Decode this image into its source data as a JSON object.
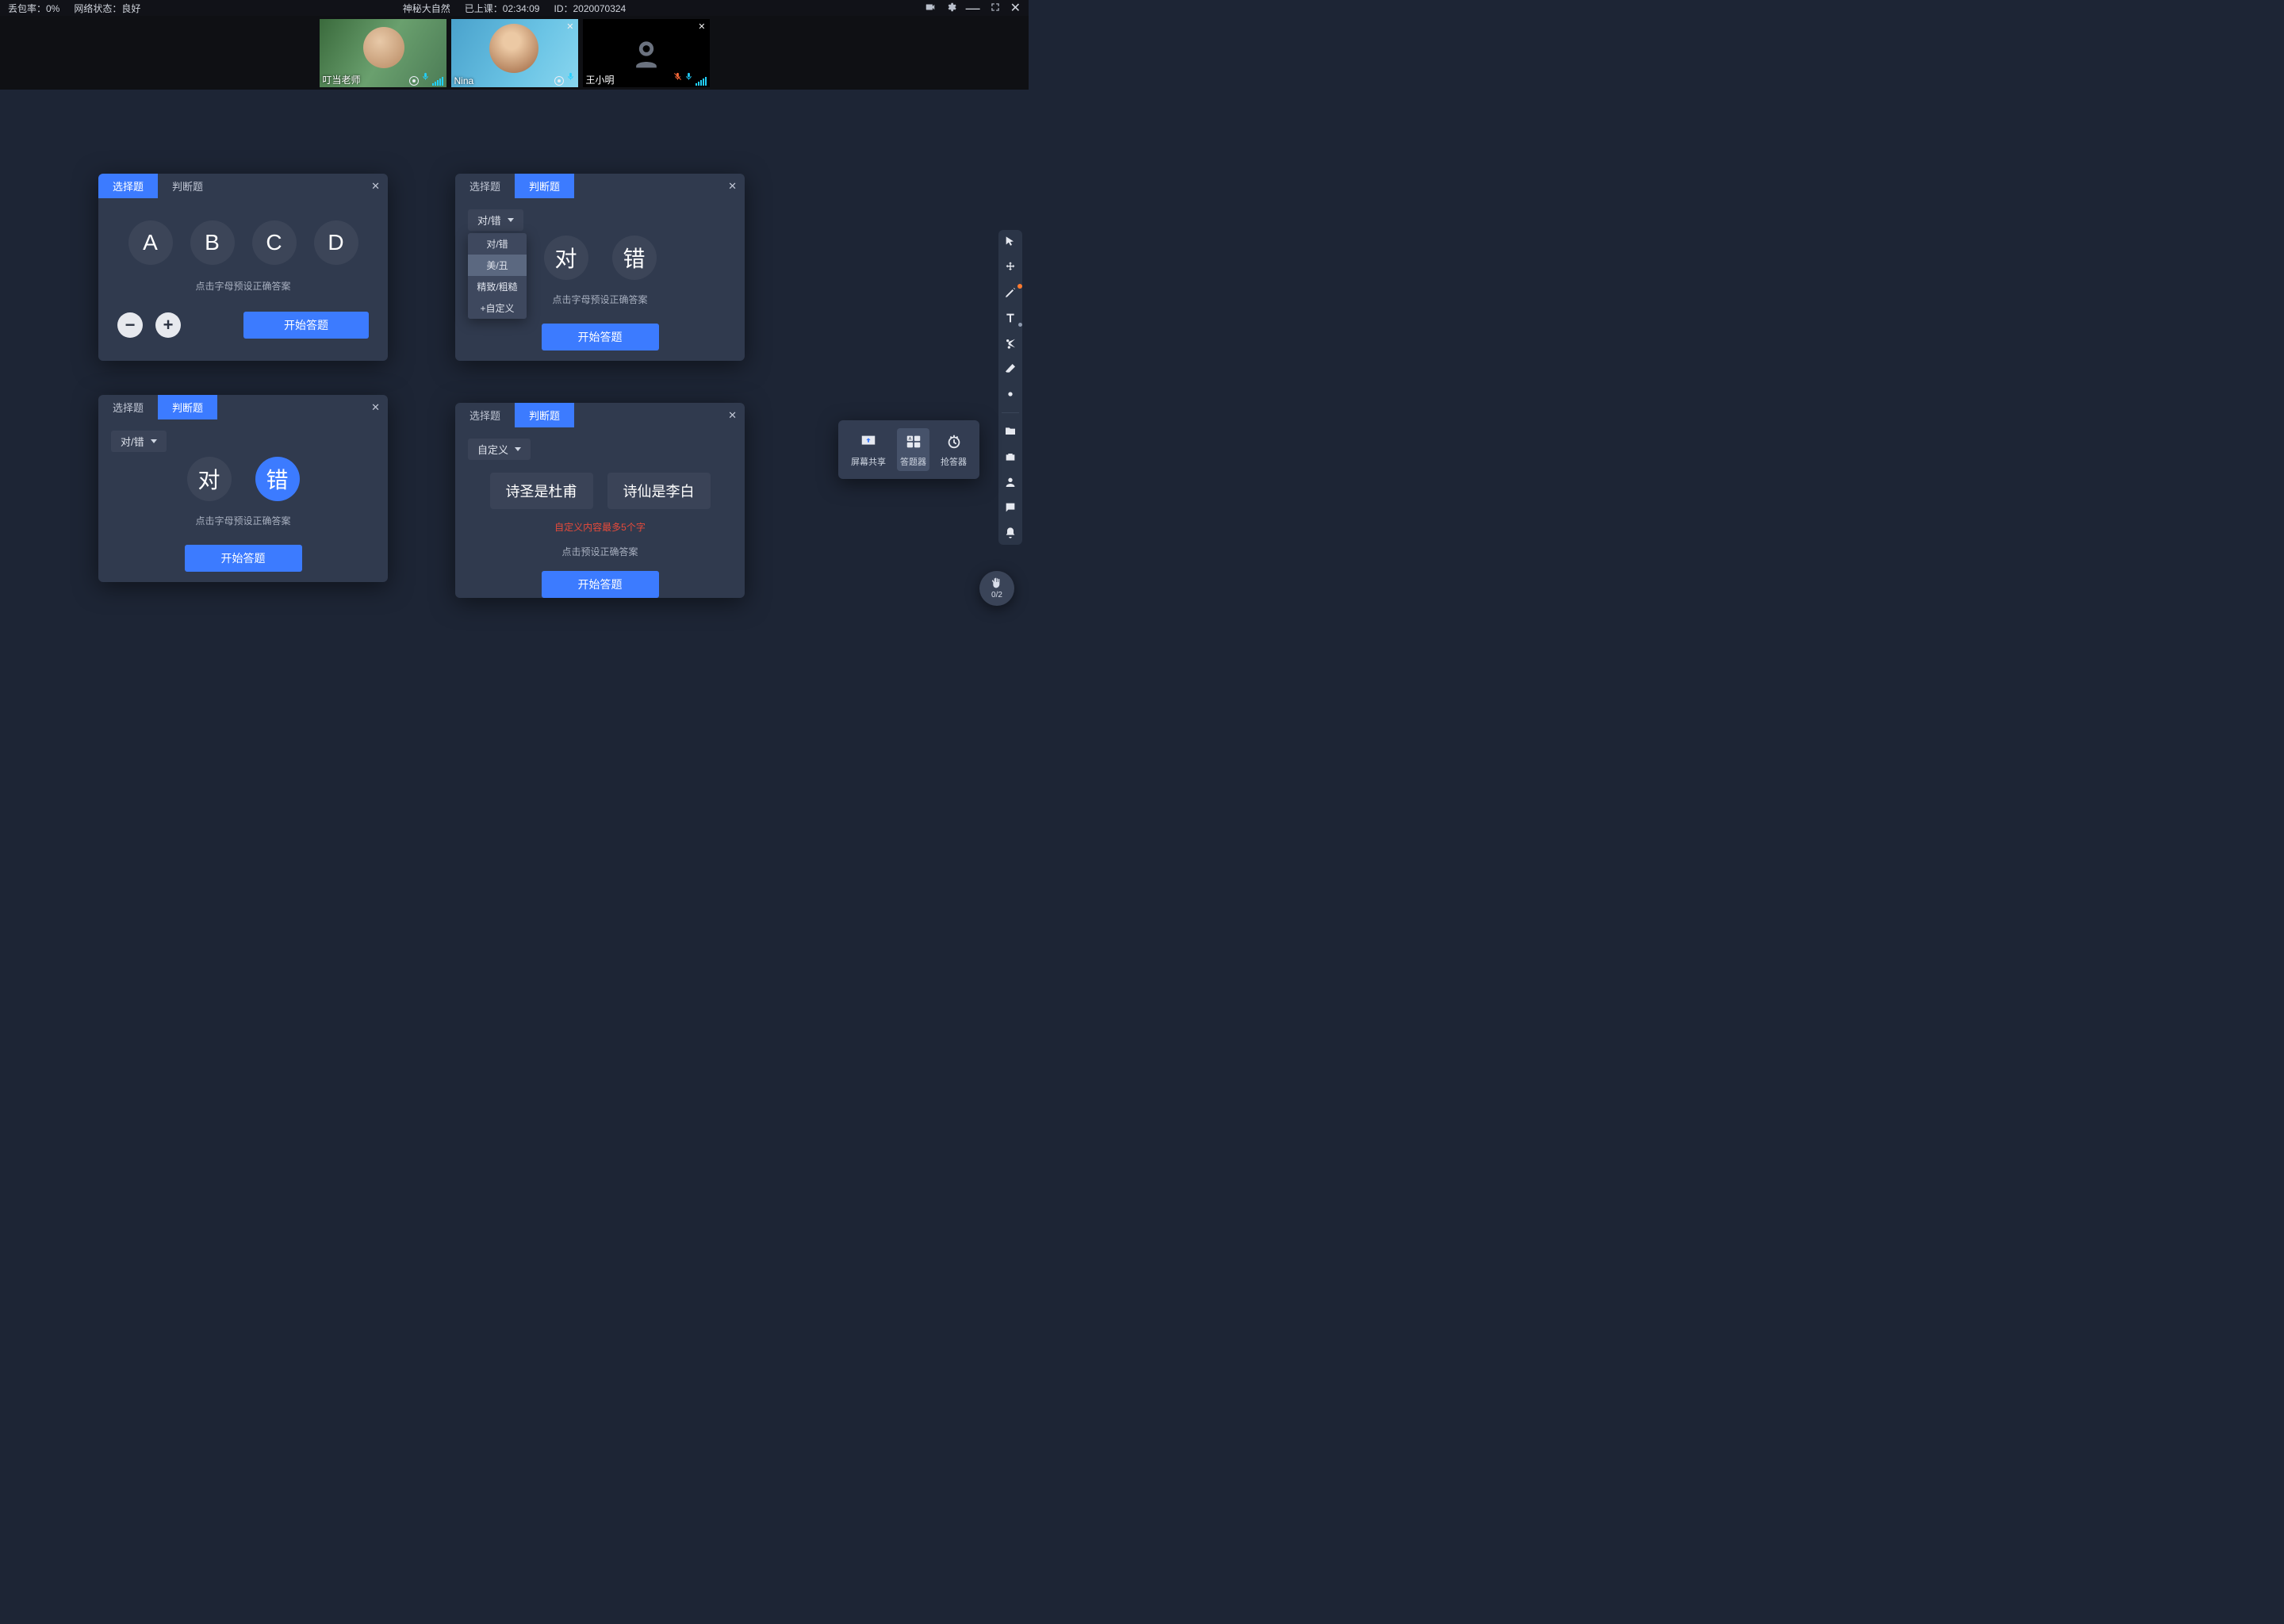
{
  "topbar": {
    "packet_loss_label": "丢包率：0%",
    "network_label": "网络状态：良好",
    "title": "神秘大自然",
    "session_label": "已上课：02:34:09",
    "id_label": "ID：2020070324"
  },
  "participants": [
    {
      "name": "叮当老师",
      "cam": "on",
      "closeable": false,
      "mic_muted": false
    },
    {
      "name": "Nina",
      "cam": "on",
      "closeable": true,
      "mic_muted": false
    },
    {
      "name": "王小明",
      "cam": "off",
      "closeable": true,
      "mic_muted": true
    }
  ],
  "panels": {
    "p1": {
      "tab_choice": "选择题",
      "tab_tf": "判断题",
      "options": [
        "A",
        "B",
        "C",
        "D"
      ],
      "hint": "点击字母预设正确答案",
      "start": "开始答题"
    },
    "p2": {
      "tab_choice": "选择题",
      "tab_tf": "判断题",
      "dd_selected": "对/错",
      "dd_items": [
        "对/错",
        "美/丑",
        "精致/粗糙",
        "+自定义"
      ],
      "opt_true": "对",
      "opt_false": "错",
      "hint": "点击字母预设正确答案",
      "start": "开始答题"
    },
    "p3": {
      "tab_choice": "选择题",
      "tab_tf": "判断题",
      "dd_selected": "对/错",
      "opt_true": "对",
      "opt_false": "错",
      "hint": "点击字母预设正确答案",
      "start": "开始答题"
    },
    "p4": {
      "tab_choice": "选择题",
      "tab_tf": "判断题",
      "dd_selected": "自定义",
      "chip1": "诗圣是杜甫",
      "chip2": "诗仙是李白",
      "err": "自定义内容最多5个字",
      "hint": "点击预设正确答案",
      "start": "开始答题"
    }
  },
  "popover": {
    "screen_share": "屏幕共享",
    "answer_tool": "答题器",
    "buzz_tool": "抢答器"
  },
  "hand": {
    "count": "0/2"
  }
}
